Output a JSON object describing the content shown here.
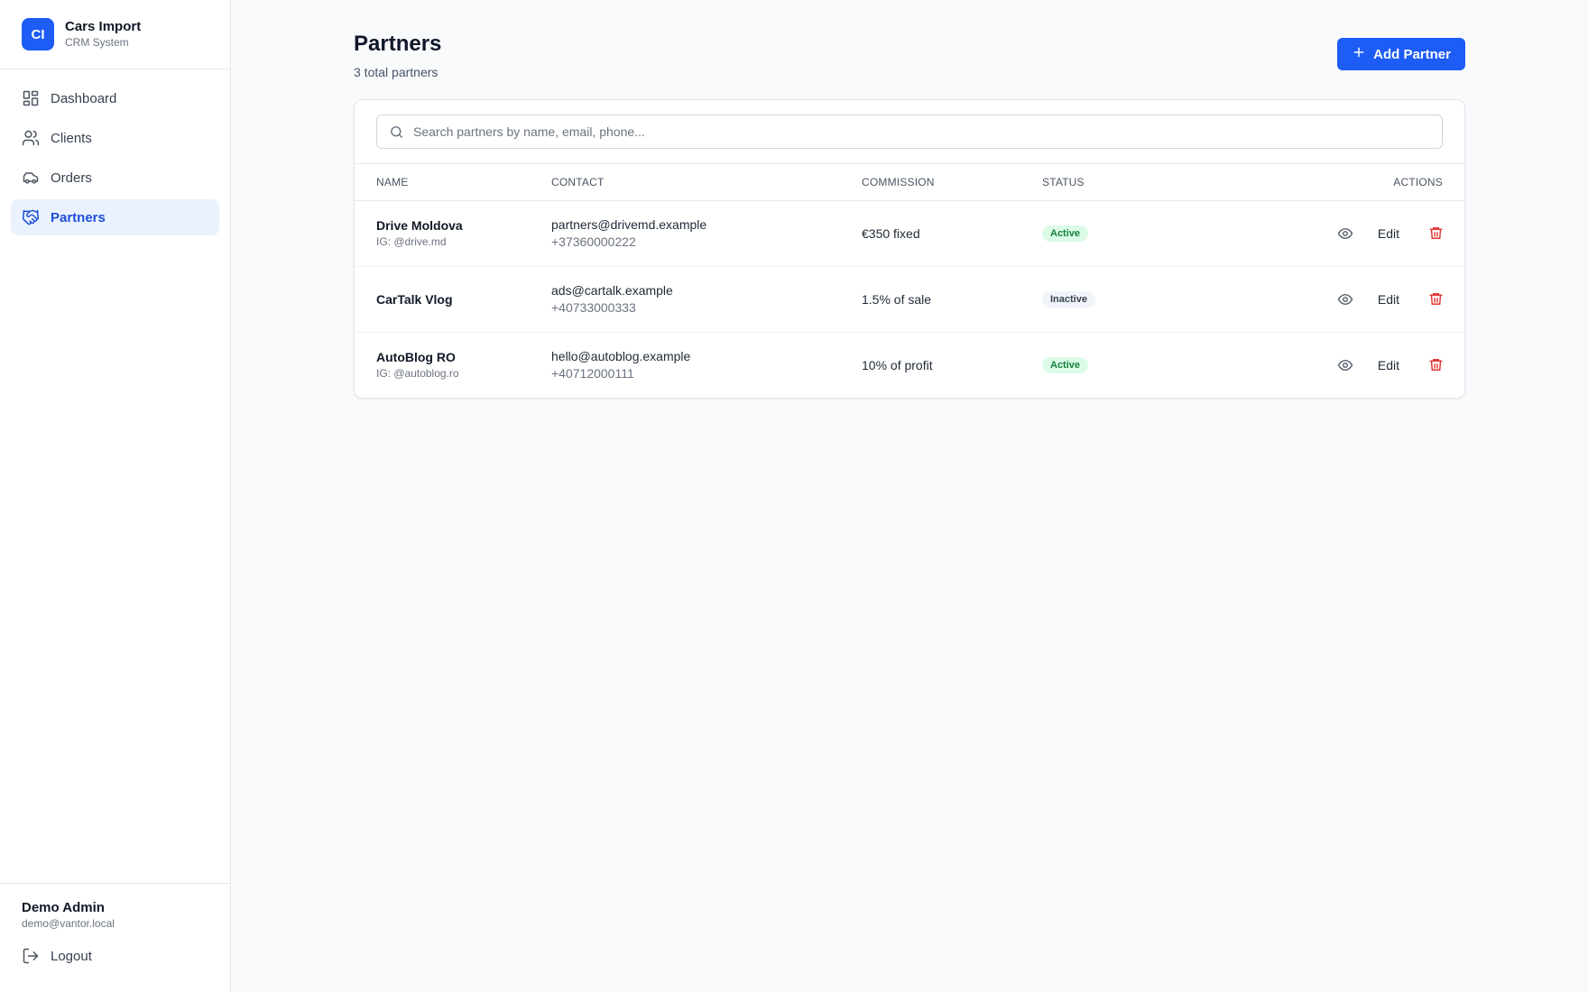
{
  "brand": {
    "logo": "CI",
    "title": "Cars Import",
    "subtitle": "CRM System",
    "accent": "#1d5cf5"
  },
  "sidebar": {
    "items": [
      {
        "label": "Dashboard",
        "icon": "dashboard-icon"
      },
      {
        "label": "Clients",
        "icon": "users-icon"
      },
      {
        "label": "Orders",
        "icon": "car-icon"
      },
      {
        "label": "Partners",
        "icon": "handshake-icon",
        "active": true
      }
    ]
  },
  "user": {
    "name": "Demo Admin",
    "email": "demo@vantor.local",
    "logout_label": "Logout"
  },
  "page": {
    "title": "Partners",
    "subtitle": "3 total partners",
    "add_button": "Add Partner"
  },
  "search": {
    "placeholder": "Search partners by name, email, phone...",
    "value": ""
  },
  "table": {
    "columns": {
      "name": "Name",
      "contact": "Contact",
      "commission": "Commission",
      "status": "Status",
      "actions": "Actions"
    },
    "rows": [
      {
        "name": "Drive Moldova",
        "ig": "IG: @drive.md",
        "email": "partners@drivemd.example",
        "phone": "+37360000222",
        "commission": "€350 fixed",
        "status": "Active",
        "edit": "Edit"
      },
      {
        "name": "CarTalk Vlog",
        "ig": "",
        "email": "ads@cartalk.example",
        "phone": "+40733000333",
        "commission": "1.5% of sale",
        "status": "Inactive",
        "edit": "Edit"
      },
      {
        "name": "AutoBlog RO",
        "ig": "IG: @autoblog.ro",
        "email": "hello@autoblog.example",
        "phone": "+40712000111",
        "commission": "10% of profit",
        "status": "Active",
        "edit": "Edit"
      }
    ]
  },
  "colors": {
    "active_badge_bg": "#dcfce7",
    "active_badge_text": "#15803d",
    "delete": "#dc2626"
  }
}
